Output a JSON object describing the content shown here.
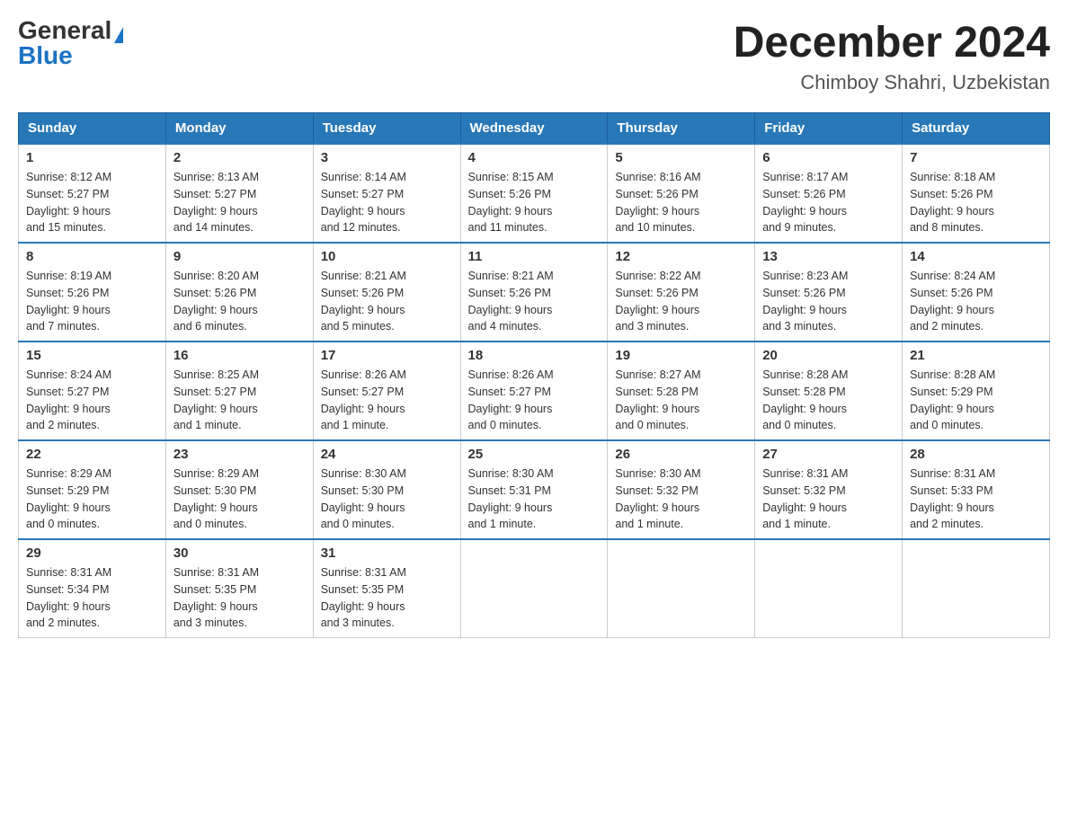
{
  "logo": {
    "general": "General",
    "blue": "Blue"
  },
  "title": {
    "month": "December 2024",
    "location": "Chimboy Shahri, Uzbekistan"
  },
  "header": {
    "days": [
      "Sunday",
      "Monday",
      "Tuesday",
      "Wednesday",
      "Thursday",
      "Friday",
      "Saturday"
    ]
  },
  "weeks": [
    [
      {
        "day": "1",
        "sunrise": "8:12 AM",
        "sunset": "5:27 PM",
        "daylight": "9 hours and 15 minutes."
      },
      {
        "day": "2",
        "sunrise": "8:13 AM",
        "sunset": "5:27 PM",
        "daylight": "9 hours and 14 minutes."
      },
      {
        "day": "3",
        "sunrise": "8:14 AM",
        "sunset": "5:27 PM",
        "daylight": "9 hours and 12 minutes."
      },
      {
        "day": "4",
        "sunrise": "8:15 AM",
        "sunset": "5:26 PM",
        "daylight": "9 hours and 11 minutes."
      },
      {
        "day": "5",
        "sunrise": "8:16 AM",
        "sunset": "5:26 PM",
        "daylight": "9 hours and 10 minutes."
      },
      {
        "day": "6",
        "sunrise": "8:17 AM",
        "sunset": "5:26 PM",
        "daylight": "9 hours and 9 minutes."
      },
      {
        "day": "7",
        "sunrise": "8:18 AM",
        "sunset": "5:26 PM",
        "daylight": "9 hours and 8 minutes."
      }
    ],
    [
      {
        "day": "8",
        "sunrise": "8:19 AM",
        "sunset": "5:26 PM",
        "daylight": "9 hours and 7 minutes."
      },
      {
        "day": "9",
        "sunrise": "8:20 AM",
        "sunset": "5:26 PM",
        "daylight": "9 hours and 6 minutes."
      },
      {
        "day": "10",
        "sunrise": "8:21 AM",
        "sunset": "5:26 PM",
        "daylight": "9 hours and 5 minutes."
      },
      {
        "day": "11",
        "sunrise": "8:21 AM",
        "sunset": "5:26 PM",
        "daylight": "9 hours and 4 minutes."
      },
      {
        "day": "12",
        "sunrise": "8:22 AM",
        "sunset": "5:26 PM",
        "daylight": "9 hours and 3 minutes."
      },
      {
        "day": "13",
        "sunrise": "8:23 AM",
        "sunset": "5:26 PM",
        "daylight": "9 hours and 3 minutes."
      },
      {
        "day": "14",
        "sunrise": "8:24 AM",
        "sunset": "5:26 PM",
        "daylight": "9 hours and 2 minutes."
      }
    ],
    [
      {
        "day": "15",
        "sunrise": "8:24 AM",
        "sunset": "5:27 PM",
        "daylight": "9 hours and 2 minutes."
      },
      {
        "day": "16",
        "sunrise": "8:25 AM",
        "sunset": "5:27 PM",
        "daylight": "9 hours and 1 minute."
      },
      {
        "day": "17",
        "sunrise": "8:26 AM",
        "sunset": "5:27 PM",
        "daylight": "9 hours and 1 minute."
      },
      {
        "day": "18",
        "sunrise": "8:26 AM",
        "sunset": "5:27 PM",
        "daylight": "9 hours and 0 minutes."
      },
      {
        "day": "19",
        "sunrise": "8:27 AM",
        "sunset": "5:28 PM",
        "daylight": "9 hours and 0 minutes."
      },
      {
        "day": "20",
        "sunrise": "8:28 AM",
        "sunset": "5:28 PM",
        "daylight": "9 hours and 0 minutes."
      },
      {
        "day": "21",
        "sunrise": "8:28 AM",
        "sunset": "5:29 PM",
        "daylight": "9 hours and 0 minutes."
      }
    ],
    [
      {
        "day": "22",
        "sunrise": "8:29 AM",
        "sunset": "5:29 PM",
        "daylight": "9 hours and 0 minutes."
      },
      {
        "day": "23",
        "sunrise": "8:29 AM",
        "sunset": "5:30 PM",
        "daylight": "9 hours and 0 minutes."
      },
      {
        "day": "24",
        "sunrise": "8:30 AM",
        "sunset": "5:30 PM",
        "daylight": "9 hours and 0 minutes."
      },
      {
        "day": "25",
        "sunrise": "8:30 AM",
        "sunset": "5:31 PM",
        "daylight": "9 hours and 1 minute."
      },
      {
        "day": "26",
        "sunrise": "8:30 AM",
        "sunset": "5:32 PM",
        "daylight": "9 hours and 1 minute."
      },
      {
        "day": "27",
        "sunrise": "8:31 AM",
        "sunset": "5:32 PM",
        "daylight": "9 hours and 1 minute."
      },
      {
        "day": "28",
        "sunrise": "8:31 AM",
        "sunset": "5:33 PM",
        "daylight": "9 hours and 2 minutes."
      }
    ],
    [
      {
        "day": "29",
        "sunrise": "8:31 AM",
        "sunset": "5:34 PM",
        "daylight": "9 hours and 2 minutes."
      },
      {
        "day": "30",
        "sunrise": "8:31 AM",
        "sunset": "5:35 PM",
        "daylight": "9 hours and 3 minutes."
      },
      {
        "day": "31",
        "sunrise": "8:31 AM",
        "sunset": "5:35 PM",
        "daylight": "9 hours and 3 minutes."
      },
      null,
      null,
      null,
      null
    ]
  ],
  "labels": {
    "sunrise": "Sunrise:",
    "sunset": "Sunset:",
    "daylight": "Daylight:"
  }
}
